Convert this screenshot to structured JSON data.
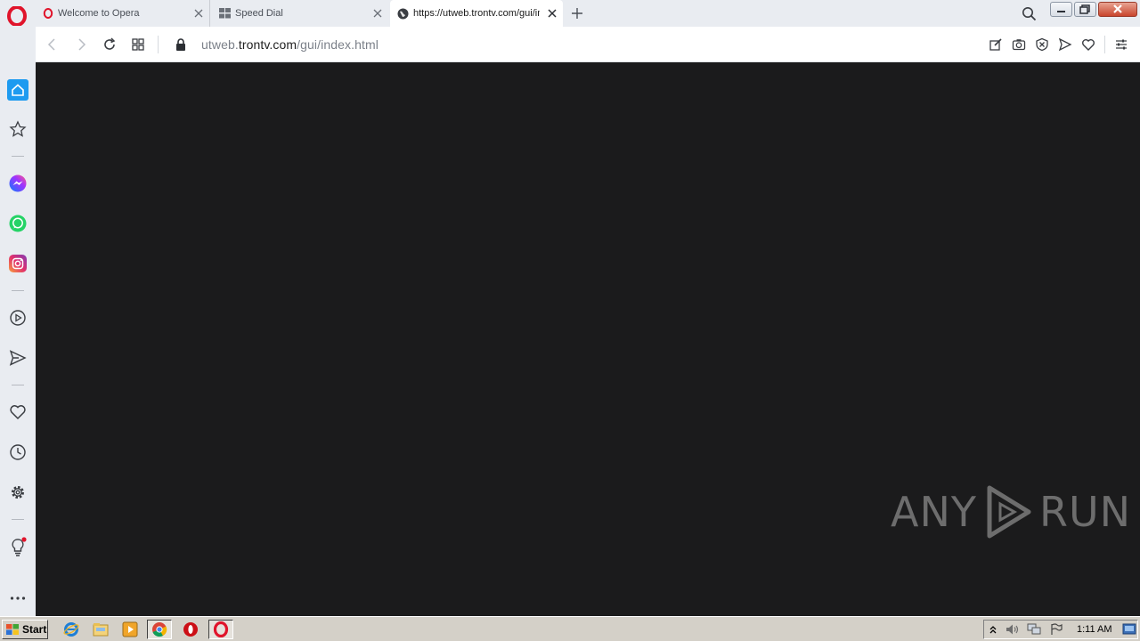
{
  "browser": {
    "tabs": [
      {
        "title": "Welcome to Opera",
        "icon": "opera-icon",
        "active": false
      },
      {
        "title": "Speed Dial",
        "icon": "speed-dial-icon",
        "active": false
      },
      {
        "title": "https://utweb.trontv.com/gui/index.html",
        "icon": "globe-icon",
        "active": true
      }
    ],
    "url": {
      "prefix": "utweb.",
      "host": "trontv.com",
      "path": "/gui/index.html"
    }
  },
  "sidebar": {
    "items": [
      "home-icon",
      "bookmarks-icon",
      "messenger-icon",
      "whatsapp-icon",
      "instagram-icon",
      "player-icon",
      "send-icon",
      "heart-icon",
      "history-icon",
      "settings-icon",
      "tips-icon",
      "more-icon"
    ]
  },
  "watermark": {
    "left": "ANY",
    "right": "RUN"
  },
  "taskbar": {
    "start_label": "Start",
    "apps": [
      "ie-icon",
      "explorer-icon",
      "media-icon",
      "chrome-icon",
      "opera-red-icon",
      "opera-icon"
    ],
    "clock": "1:11 AM"
  },
  "colors": {
    "accent": "#1e9bf0",
    "opera_red": "#e0142b",
    "content_bg": "#1b1b1c"
  }
}
